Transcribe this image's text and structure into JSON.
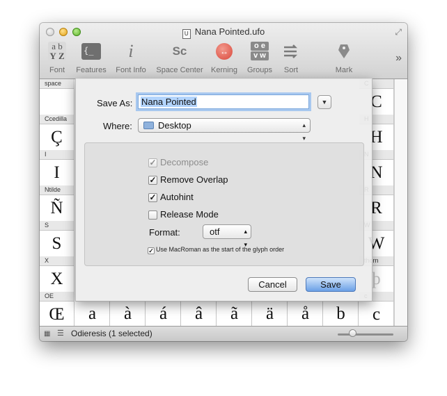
{
  "window": {
    "title": "Nana Pointed.ufo",
    "doc_icon": "U"
  },
  "toolbar": {
    "items": [
      {
        "label": "Font",
        "icon": "font-icon"
      },
      {
        "label": "Features",
        "icon": "features-icon"
      },
      {
        "label": "Font Info",
        "icon": "font-info-icon"
      },
      {
        "label": "Space Center",
        "icon": "space-center-icon"
      },
      {
        "label": "Kerning",
        "icon": "kerning-icon"
      },
      {
        "label": "Groups",
        "icon": "groups-icon"
      },
      {
        "label": "Sort",
        "icon": "sort-icon"
      },
      {
        "label": "Mark",
        "icon": "mark-icon"
      }
    ],
    "font_icon_letters": [
      "a",
      "b",
      "Y",
      "Z"
    ],
    "features_glyph": "{_",
    "space_center_glyph": "Sc",
    "groups_glyphs": [
      "o e",
      "v w"
    ],
    "overflow": "»"
  },
  "glyph_grid": {
    "left_cells": [
      {
        "name": "space",
        "glyph": ""
      },
      {
        "name": "Ccedilla",
        "glyph": "Ç"
      },
      {
        "name": "I",
        "glyph": "I"
      },
      {
        "name": "Ntilde",
        "glyph": "Ñ"
      },
      {
        "name": "S",
        "glyph": "S"
      },
      {
        "name": "X",
        "glyph": "X"
      },
      {
        "name": "OE",
        "glyph": "Œ"
      }
    ],
    "right_cells": [
      {
        "name": "C",
        "glyph": "C"
      },
      {
        "name": "H",
        "glyph": "H"
      },
      {
        "name": "N",
        "glyph": "N"
      },
      {
        "name": "R",
        "glyph": "R"
      },
      {
        "name": "W",
        "glyph": "W"
      },
      {
        "name": "thorn",
        "glyph": "þ"
      },
      {
        "name": "c",
        "glyph": "c"
      }
    ],
    "bottom_row": [
      "a",
      "à",
      "á",
      "â",
      "ã",
      "ä",
      "å",
      "b"
    ]
  },
  "status_bar": {
    "text": "Odieresis (1 selected)"
  },
  "save_sheet": {
    "save_as_label": "Save As:",
    "file_name": "Nana Pointed",
    "where_label": "Where:",
    "where_value": "Desktop",
    "options": [
      {
        "label": "Decompose",
        "checked": true,
        "enabled": false
      },
      {
        "label": "Remove Overlap",
        "checked": true,
        "enabled": true
      },
      {
        "label": "Autohint",
        "checked": true,
        "enabled": true
      },
      {
        "label": "Release Mode",
        "checked": false,
        "enabled": true
      }
    ],
    "format_label": "Format:",
    "format_value": "otf",
    "macroman_label": "Use MacRoman as the start of the glyph order",
    "macroman_checked": true,
    "cancel_label": "Cancel",
    "save_label": "Save"
  }
}
